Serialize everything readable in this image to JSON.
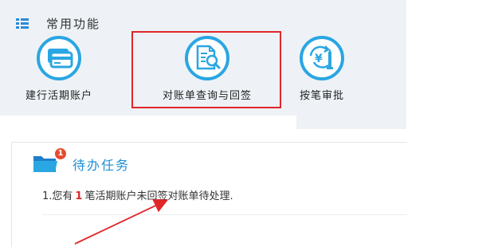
{
  "common_functions": {
    "title": "常用功能",
    "items": [
      {
        "label": "建行活期账户",
        "icon": "card-icon"
      },
      {
        "label": "对账单查询与回签",
        "icon": "document-search-icon"
      },
      {
        "label": "按笔审批",
        "icon": "yen-approve-icon"
      }
    ]
  },
  "todo": {
    "title": "待办任务",
    "badge": "1",
    "item_prefix": "1.您有",
    "item_count": "1",
    "item_suffix": "笔活期账户未回签对账单待处理."
  },
  "colors": {
    "accent": "#2aa6e2",
    "highlight": "#e0262a",
    "title_blue": "#1e8fd6"
  }
}
